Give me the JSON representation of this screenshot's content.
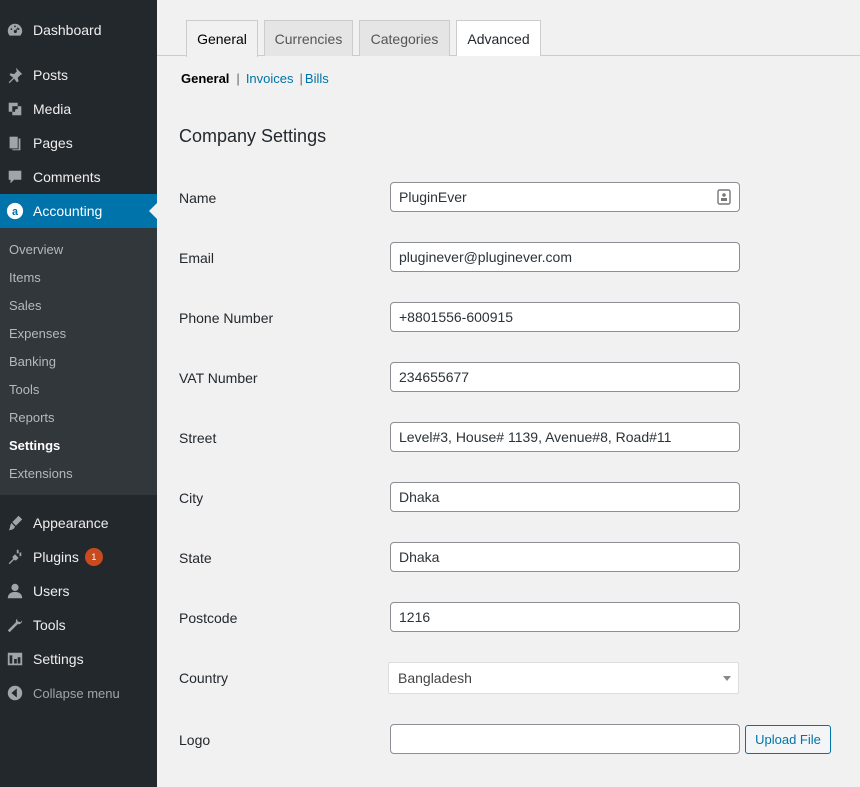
{
  "sidebar": {
    "top_items": [
      {
        "label": "Dashboard",
        "icon": "dashboard-icon"
      },
      {
        "label": "Posts",
        "icon": "pin-icon"
      },
      {
        "label": "Media",
        "icon": "media-icon"
      },
      {
        "label": "Pages",
        "icon": "pages-icon"
      },
      {
        "label": "Comments",
        "icon": "comment-icon"
      },
      {
        "label": "Accounting",
        "icon": "accounting-icon"
      }
    ],
    "submenu": [
      "Overview",
      "Items",
      "Sales",
      "Expenses",
      "Banking",
      "Tools",
      "Reports",
      "Settings",
      "Extensions"
    ],
    "bottom_items": [
      {
        "label": "Appearance",
        "icon": "brush-icon"
      },
      {
        "label": "Plugins",
        "icon": "plugin-icon",
        "badge": "1"
      },
      {
        "label": "Users",
        "icon": "user-icon"
      },
      {
        "label": "Tools",
        "icon": "wrench-icon"
      },
      {
        "label": "Settings",
        "icon": "settings-icon"
      }
    ],
    "collapse_label": "Collapse menu"
  },
  "tabs": [
    "General",
    "Currencies",
    "Categories",
    "Advanced"
  ],
  "subnav": {
    "current": "General",
    "links": [
      "Invoices",
      "Bills"
    ]
  },
  "section_title": "Company Settings",
  "form": {
    "name_label": "Name",
    "name_value": "PluginEver",
    "email_label": "Email",
    "email_value": "pluginever@pluginever.com",
    "phone_label": "Phone Number",
    "phone_value": "+8801556-600915",
    "vat_label": "VAT Number",
    "vat_value": "234655677",
    "street_label": "Street",
    "street_value": "Level#3, House# 1139, Avenue#8, Road#11",
    "city_label": "City",
    "city_value": "Dhaka",
    "state_label": "State",
    "state_value": "Dhaka",
    "postcode_label": "Postcode",
    "postcode_value": "1216",
    "country_label": "Country",
    "country_value": "Bangladesh",
    "logo_label": "Logo",
    "logo_value": "",
    "upload_label": "Upload File"
  },
  "colors": {
    "sidebar": "#23282d",
    "submenu": "#32373c",
    "accent": "#0073aa",
    "badge": "#ca4a1f"
  }
}
